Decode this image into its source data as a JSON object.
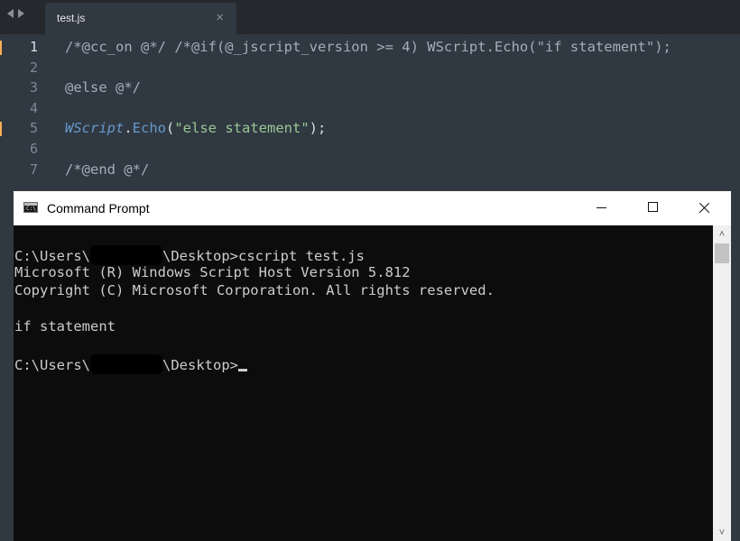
{
  "editor": {
    "tab": {
      "title": "test.js",
      "close_glyph": "×"
    },
    "lines": [
      {
        "num": "1",
        "active": true,
        "modified": true,
        "tokens": [
          {
            "t": "/*@cc_on @*/ /*@if(@_jscript_version >= 4) WScript.Echo(\"if statement\");",
            "k": "comment"
          }
        ]
      },
      {
        "num": "2",
        "active": false,
        "modified": false,
        "tokens": []
      },
      {
        "num": "3",
        "active": false,
        "modified": false,
        "tokens": [
          {
            "t": "@else @*/",
            "k": "comment"
          }
        ]
      },
      {
        "num": "4",
        "active": false,
        "modified": false,
        "tokens": []
      },
      {
        "num": "5",
        "active": false,
        "modified": true,
        "tokens": [
          {
            "t": "WScript",
            "k": "class"
          },
          {
            "t": ".",
            "k": "punct"
          },
          {
            "t": "Echo",
            "k": "func"
          },
          {
            "t": "(",
            "k": "punct"
          },
          {
            "t": "\"else statement\"",
            "k": "string"
          },
          {
            "t": ");",
            "k": "punct"
          }
        ]
      },
      {
        "num": "6",
        "active": false,
        "modified": false,
        "tokens": []
      },
      {
        "num": "7",
        "active": false,
        "modified": false,
        "tokens": [
          {
            "t": "/*@end @*/",
            "k": "comment"
          }
        ]
      }
    ],
    "colors": {
      "background": "#303841",
      "modified_marker": "#f9ae58",
      "string": "#99c794",
      "keyword_blue": "#6699cc"
    }
  },
  "cmd": {
    "title": "Command Prompt",
    "icon_text": "C:\\",
    "scroll_up_glyph": "˄",
    "scroll_down_glyph": "˅",
    "lines": [
      {
        "pre": "C:\\Users\\",
        "redacted": true,
        "post": "\\Desktop>cscript test.js",
        "cursor": false
      },
      {
        "pre": "Microsoft (R) Windows Script Host Version 5.812",
        "redacted": false,
        "post": "",
        "cursor": false
      },
      {
        "pre": "Copyright (C) Microsoft Corporation. All rights reserved.",
        "redacted": false,
        "post": "",
        "cursor": false
      },
      {
        "pre": "",
        "redacted": false,
        "post": "",
        "cursor": false
      },
      {
        "pre": "if statement",
        "redacted": false,
        "post": "",
        "cursor": false
      },
      {
        "pre": "",
        "redacted": false,
        "post": "",
        "cursor": false
      },
      {
        "pre": "C:\\Users\\",
        "redacted": true,
        "post": "\\Desktop>",
        "cursor": true
      }
    ]
  }
}
